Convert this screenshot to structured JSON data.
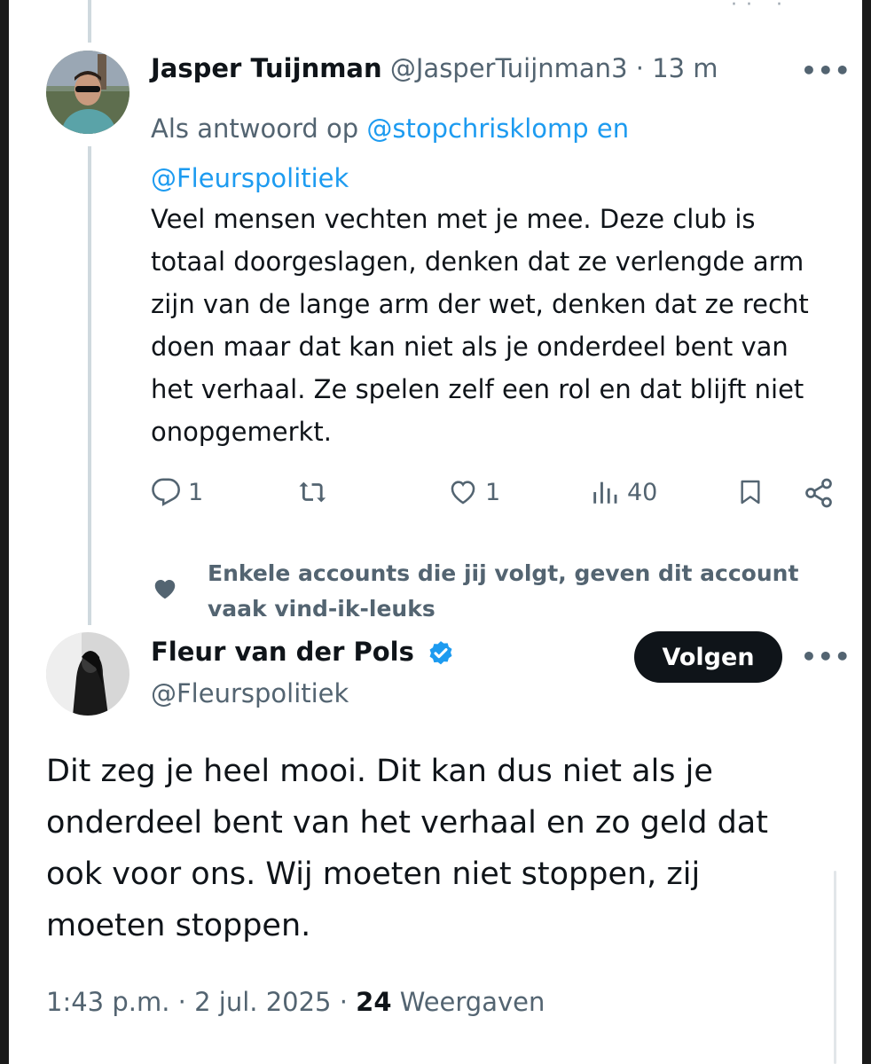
{
  "reply_tweet": {
    "author_name": "Jasper Tuijnman",
    "handle": "@JasperTuijnman3",
    "separator": "·",
    "time_ago": "13 m",
    "more_label": "•••",
    "reply_prefix": "Als antwoord op",
    "mention_1": "@stopchrisklomp",
    "reply_and": "en",
    "mention_2": "@Fleurspolitiek",
    "body": "Veel mensen vechten met je mee. Deze club is totaal doorgeslagen, denken dat ze verlengde arm zijn van de lange arm der wet, denken dat ze recht doen maar dat kan niet als je onderdeel bent van het verhaal. Ze spelen zelf een rol en dat blijft niet onopgemerkt.",
    "actions": {
      "replies": "1",
      "likes": "1",
      "views": "40"
    }
  },
  "social_context": "Enkele accounts die jij volgt, geven dit account vaak vind-ik-leuks",
  "main_tweet": {
    "author_name": "Fleur van der Pols",
    "handle": "@Fleurspolitiek",
    "follow_label": "Volgen",
    "more_label": "•••",
    "body": "Dit zeg je heel mooi. Dit kan dus niet als je onderdeel bent van het verhaal en zo geld dat ook voor ons. Wij moeten niet stoppen, zij moeten stoppen.",
    "time": "1:43 p.m.",
    "separator": "·",
    "date": "2 jul. 2025",
    "view_count": "24",
    "views_label": "Weergaven"
  },
  "colors": {
    "text_primary": "#0f1419",
    "text_secondary": "#536471",
    "link": "#1d9bf0",
    "verified": "#1d9bf0",
    "follow_bg": "#0f1419"
  }
}
